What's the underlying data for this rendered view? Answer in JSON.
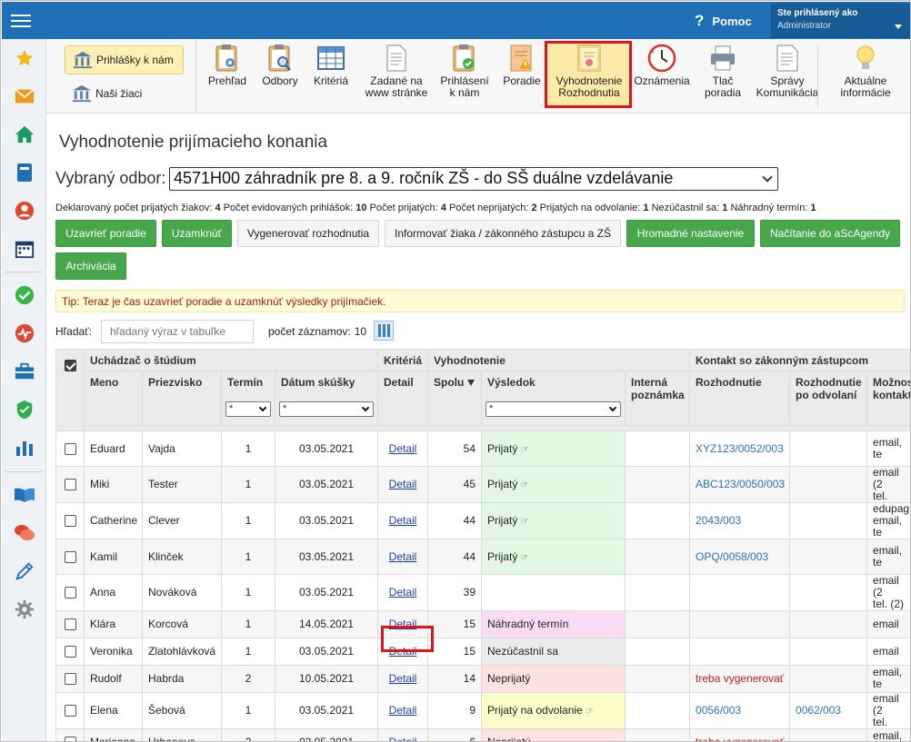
{
  "topbar": {
    "help_label": "Pomoc",
    "user_line1": "Ste prihlásený ako",
    "user_line2": "Administrator"
  },
  "apps": [
    {
      "label": "Prihlášky k nám",
      "active": true
    },
    {
      "label": "Naši žiaci",
      "active": false
    }
  ],
  "toolbar": [
    {
      "label": "Prehľad",
      "icon": "clipboard-eye-icon"
    },
    {
      "label": "Odbory",
      "icon": "clipboard-search-icon"
    },
    {
      "label": "Kritériá",
      "icon": "table-icon"
    },
    {
      "label": "Zadané na\nwww stránke",
      "icon": "document-icon"
    },
    {
      "label": "Prihlásení\nk nám",
      "icon": "clipboard-check-icon"
    },
    {
      "label": "Poradie",
      "icon": "warning-doc-icon"
    },
    {
      "label": "Vyhodnotenie\nRozhodnutia",
      "icon": "certificate-icon",
      "active": true
    },
    {
      "label": "Oznámenia",
      "icon": "clock-icon"
    },
    {
      "label": "Tlač\nporadia",
      "icon": "printer-icon"
    },
    {
      "label": "Správy\nKomunikácia",
      "icon": "message-doc-icon"
    },
    {
      "label": "Aktuálne\ninformácie",
      "icon": "lightbulb-icon"
    }
  ],
  "page": {
    "title": "Vyhodnotenie prijímacieho konania",
    "field_label": "Vybraný odbor:",
    "field_value": "4571H00 záhradník pre 8. a 9. ročník ZŠ - do SŠ duálne vzdelávanie"
  },
  "stats": [
    {
      "label": "Deklarovaný počet prijatých žiakov:",
      "value": "4"
    },
    {
      "label": "Počet evidovaných prihlášok:",
      "value": "10"
    },
    {
      "label": "Počet prijatých:",
      "value": "4"
    },
    {
      "label": "Počet neprijatých:",
      "value": "2"
    },
    {
      "label": "Prijatých na odvolanie:",
      "value": "1"
    },
    {
      "label": "Nezúčastnil sa:",
      "value": "1"
    },
    {
      "label": "Náhradný termín:",
      "value": "1"
    }
  ],
  "actions": [
    {
      "label": "Uzavrieť poradie",
      "style": "g"
    },
    {
      "label": "Uzamknúť",
      "style": "g"
    },
    {
      "label": "Vygenerovať rozhodnutia",
      "style": "w"
    },
    {
      "label": "Informovať žiaka / zákonného zástupcu a ZŠ",
      "style": "w"
    },
    {
      "label": "Hromadné nastavenie",
      "style": "g"
    },
    {
      "label": "Načítanie do aScAgendy",
      "style": "g"
    },
    {
      "label": "Archivácia",
      "style": "g"
    }
  ],
  "tip": "Tip: Teraz je čas uzavrieť poradie a uzamknúť výsledky prijímačiek.",
  "search": {
    "label": "Hľadať:",
    "placeholder": "hľadaný výraz v tabuľke"
  },
  "count": {
    "label": "počet záznamov:",
    "value": "10"
  },
  "table": {
    "groups": [
      "Uchádzač o štúdium",
      "Kritériá",
      "Vyhodnotenie",
      "Kontakt so zákonným zástupcom"
    ],
    "headers": [
      "Meno",
      "Priezvisko",
      "Termín",
      "Dátum skúšky",
      "Detail",
      "Spolu",
      "Výsledok",
      "Interná poznámka",
      "Rozhodnutie",
      "Rozhodnutie po odvolaní",
      "Možnosti kontaktu"
    ],
    "filter_value": "*",
    "detail_label": "Detail",
    "rows": [
      {
        "first": "Eduard",
        "last": "Vajda",
        "term": "1",
        "date": "03.05.2021",
        "total": "54",
        "result": "Prijatý",
        "result_class": "res-accept",
        "hand": true,
        "decision": "XYZ123/0052/003",
        "decision_class": "blue",
        "appeal": "",
        "contact": "email, te"
      },
      {
        "first": "Miki",
        "last": "Tester",
        "term": "1",
        "date": "03.05.2021",
        "total": "45",
        "result": "Prijatý",
        "result_class": "res-accept",
        "hand": true,
        "decision": "ABC123/0050/003",
        "decision_class": "blue",
        "appeal": "",
        "contact": "email (2\ntel."
      },
      {
        "first": "Catherine",
        "last": "Clever",
        "term": "1",
        "date": "03.05.2021",
        "total": "44",
        "result": "Prijatý",
        "result_class": "res-accept",
        "hand": true,
        "decision": "2043/003",
        "decision_class": "blue",
        "appeal": "",
        "contact": "edupag\nemail, te"
      },
      {
        "first": "Kamil",
        "last": "Klinček",
        "term": "1",
        "date": "03.05.2021",
        "total": "44",
        "result": "Prijatý",
        "result_class": "res-accept",
        "hand": true,
        "decision": "OPQ/0058/003",
        "decision_class": "blue",
        "appeal": "",
        "contact": "email, te"
      },
      {
        "first": "Anna",
        "last": "Nováková",
        "term": "1",
        "date": "03.05.2021",
        "total": "39",
        "result": "",
        "result_class": "",
        "hand": false,
        "decision": "",
        "decision_class": "",
        "appeal": "",
        "contact": "email (2\ntel. (2)"
      },
      {
        "first": "Klára",
        "last": "Korcová",
        "term": "1",
        "date": "14.05.2021",
        "total": "15",
        "result": "Náhradný termín",
        "result_class": "res-nahr",
        "hand": false,
        "decision": "",
        "decision_class": "",
        "appeal": "",
        "contact": "email"
      },
      {
        "first": "Veronika",
        "last": "Zlatohlávková",
        "term": "1",
        "date": "03.05.2021",
        "total": "15",
        "result": "Nezúčastnil sa",
        "result_class": "res-nez",
        "hand": false,
        "decision": "",
        "decision_class": "",
        "appeal": "",
        "contact": "email"
      },
      {
        "first": "Rudolf",
        "last": "Habrda",
        "term": "2",
        "date": "10.05.2021",
        "total": "14",
        "result": "Neprijatý",
        "result_class": "res-nepr",
        "hand": false,
        "decision": "treba vygenerovať",
        "decision_class": "red",
        "appeal": "",
        "contact": "email, te"
      },
      {
        "first": "Elena",
        "last": "Šebová",
        "term": "1",
        "date": "03.05.2021",
        "total": "9",
        "result": "Prijatý na odvolanie",
        "result_class": "res-odv",
        "hand": true,
        "decision": "0056/003",
        "decision_class": "blue",
        "appeal": "0062/003",
        "contact": "email (2\ntel."
      },
      {
        "first": "Marianna",
        "last": "Urbanova",
        "term": "2",
        "date": "03.05.2021",
        "total": "6",
        "result": "Neprijatý",
        "result_class": "res-nepr",
        "hand": false,
        "decision": "treba vygenerovať",
        "decision_class": "red",
        "appeal": "",
        "contact": "email, te"
      }
    ]
  }
}
